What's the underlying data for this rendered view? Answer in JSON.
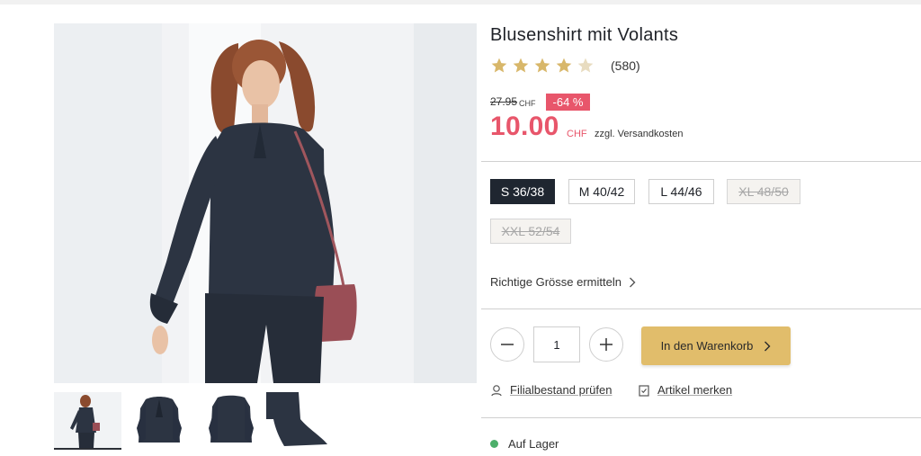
{
  "product": {
    "title": "Blusenshirt mit Volants",
    "rating": {
      "stars_filled": 4,
      "stars_total": 5,
      "count_label": "(580)"
    },
    "price": {
      "old": "27.95",
      "old_currency": "CHF",
      "discount": "-64 %",
      "current": "10.00",
      "currency": "CHF",
      "shipping_note": "zzgl. Versandkosten"
    },
    "sizes": [
      {
        "label": "S 36/38",
        "state": "selected"
      },
      {
        "label": "M 40/42",
        "state": "available"
      },
      {
        "label": "L 44/46",
        "state": "available"
      },
      {
        "label": "XL 48/50",
        "state": "unavailable"
      },
      {
        "label": "XXL 52/54",
        "state": "unavailable"
      }
    ],
    "size_guide_label": "Richtige Grösse ermitteln",
    "quantity": "1",
    "add_to_cart_label": "In den Warenkorb",
    "store_stock_label": "Filialbestand prüfen",
    "wishlist_label": "Artikel merken",
    "availability_label": "Auf Lager"
  },
  "colors": {
    "accent_price": "#e8566b",
    "cart_button": "#e1bd6b",
    "star_filled": "#d8b76a",
    "star_empty": "#e8dcc0",
    "selected_size": "#1f2630",
    "in_stock": "#4caf6a"
  },
  "icons": {
    "star": "star-icon",
    "chevron": "chevron-right-icon",
    "minus": "minus-icon",
    "plus": "plus-icon",
    "store": "location-pin-icon",
    "wishlist": "clipboard-check-icon"
  }
}
